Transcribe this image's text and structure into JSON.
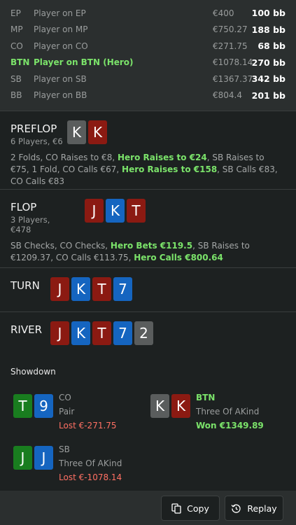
{
  "seats": [
    {
      "pos": "EP",
      "name": "Player on EP",
      "stack": "€400",
      "bb": "100 bb",
      "hero": false
    },
    {
      "pos": "MP",
      "name": "Player on MP",
      "stack": "€750.27",
      "bb": "188 bb",
      "hero": false
    },
    {
      "pos": "CO",
      "name": "Player on CO",
      "stack": "€271.75",
      "bb": "68 bb",
      "hero": false
    },
    {
      "pos": "BTN",
      "name": "Player on BTN (Hero)",
      "stack": "€1078.14",
      "bb": "270 bb",
      "hero": true
    },
    {
      "pos": "SB",
      "name": "Player on SB",
      "stack": "€1367.37",
      "bb": "342 bb",
      "hero": false
    },
    {
      "pos": "BB",
      "name": "Player on BB",
      "stack": "€804.4",
      "bb": "201 bb",
      "hero": false
    }
  ],
  "streets": {
    "preflop": {
      "title": "PREFLOP",
      "subtitle": "6 Players, €6",
      "cards": [
        "K",
        "K"
      ],
      "actions": {
        "a1": "2 Folds, CO Raises to €8, ",
        "h1": "Hero Raises to €24",
        "a2": ", SB Raises to €75, 1 Fold, CO Calls €67, ",
        "h2": "Hero Raises to €158",
        "a3": ", SB Calls €83, CO Calls €83"
      }
    },
    "flop": {
      "title": "FLOP",
      "subtitle": "3 Players, €478",
      "cards": [
        "J",
        "K",
        "T"
      ],
      "actions": {
        "a1": "SB Checks, CO Checks, ",
        "h1": "Hero Bets €119.5",
        "a2": ", SB Raises to €1209.37, CO Calls €113.75, ",
        "h2": "Hero Calls €800.64"
      }
    },
    "turn": {
      "title": "TURN",
      "cards": [
        "J",
        "K",
        "T",
        "7"
      ]
    },
    "river": {
      "title": "RIVER",
      "cards": [
        "J",
        "K",
        "T",
        "7",
        "2"
      ]
    }
  },
  "showdown": {
    "title": "Showdown",
    "players": [
      {
        "pos": "CO",
        "cards": [
          "T",
          "9"
        ],
        "hand": "Pair",
        "result": "Lost €-271.75"
      },
      {
        "pos": "BTN",
        "cards": [
          "K",
          "K"
        ],
        "hand": "Three Of AKind",
        "result": "Won €1349.89"
      },
      {
        "pos": "SB",
        "cards": [
          "J",
          "J"
        ],
        "hand": "Three Of AKind",
        "result": "Lost €-1078.14"
      }
    ]
  },
  "footer": {
    "copy_label": "Copy",
    "replay_label": "Replay"
  },
  "colors": {
    "accent_green": "#7be36a",
    "loss_red": "#ff7063",
    "card_red": "#8b1a12",
    "card_blue": "#1565c0",
    "card_green": "#197d1f",
    "card_gray": "#5a5d5d"
  },
  "icons": {
    "copy": "copy-icon",
    "replay": "replay-icon"
  }
}
